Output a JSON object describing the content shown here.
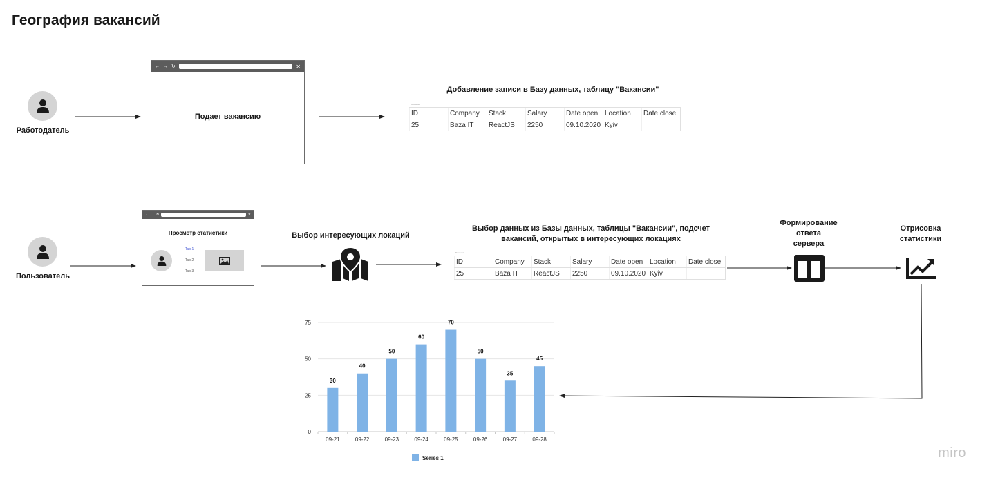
{
  "page": {
    "title": "География вакансий",
    "watermark": "miro"
  },
  "flow1": {
    "actor": "Работодатель",
    "browser_caption": "Подает вакансию",
    "db_caption": "Добавление записи в Базу данных, таблицу \"Вакансии\"",
    "table_label": "Вакансии",
    "columns": [
      "ID",
      "Company",
      "Stack",
      "Salary",
      "Date open",
      "Location",
      "Date close"
    ],
    "row": [
      "25",
      "Baza IT",
      "ReactJS",
      "2250",
      "09.10.2020",
      "Kyiv",
      ""
    ]
  },
  "flow2": {
    "actor": "Пользователь",
    "browser_title": "Просмотр статистики",
    "tabs": [
      "Tab 1",
      "Tab 2",
      "Tab 3"
    ],
    "locations_caption": "Выбор интересующих локаций",
    "db_caption_line1": "Выбор данных из Базы данных, таблицы \"Вакансии\", подсчет",
    "db_caption_line2": "вакансий, открытых в интересующих локациях",
    "table_label": "Вакансии",
    "columns": [
      "ID",
      "Company",
      "Stack",
      "Salary",
      "Date open",
      "Location",
      "Date close"
    ],
    "row": [
      "25",
      "Baza IT",
      "ReactJS",
      "2250",
      "09.10.2020",
      "Kyiv",
      ""
    ],
    "server_caption_line1": "Формирование",
    "server_caption_line2": "ответа",
    "server_caption_line3": "сервера",
    "render_caption_line1": "Отрисовка",
    "render_caption_line2": "статистики"
  },
  "icons": {
    "actor": "user-icon",
    "map": "map-pin-icon",
    "layout": "two-column-layout-icon",
    "trend": "trending-up-chart-icon",
    "image": "image-icon"
  },
  "colors": {
    "bar": "#7fb3e6",
    "browser_bar": "#5c5c5c",
    "avatar": "#d4d4d4"
  },
  "chart_data": {
    "type": "bar",
    "categories": [
      "09-21",
      "09-22",
      "09-23",
      "09-24",
      "09-25",
      "09-26",
      "09-27",
      "09-28"
    ],
    "series": [
      {
        "name": "Series 1",
        "values": [
          30,
          40,
          50,
          60,
          70,
          50,
          35,
          45
        ]
      }
    ],
    "yticks": [
      "0",
      "25",
      "50",
      "75"
    ],
    "ylim": [
      0,
      75
    ],
    "grid": true,
    "legend_position": "bottom"
  }
}
